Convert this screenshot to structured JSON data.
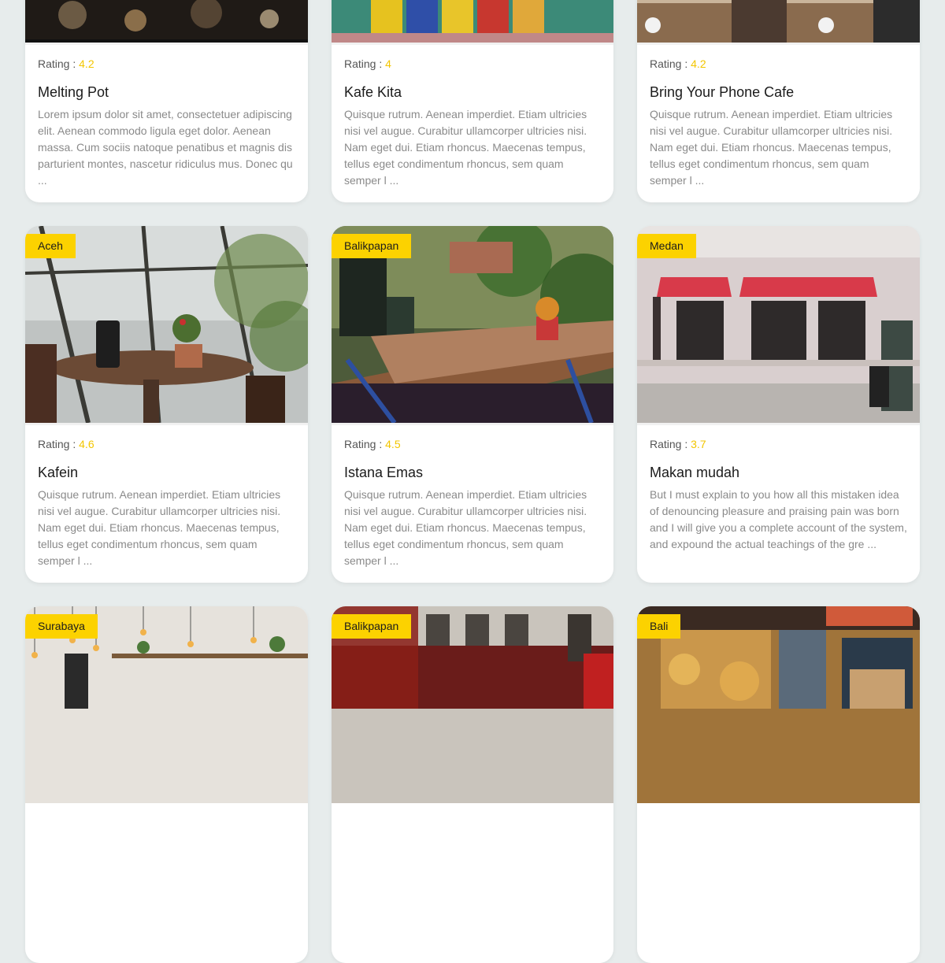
{
  "cards": [
    {
      "city": "",
      "rating_label": "Rating : ",
      "rating": "4.2",
      "title": "Melting Pot",
      "description": "Lorem ipsum dolor sit amet, consectetuer adipiscing elit. Aenean commodo ligula eget dolor. Aenean massa. Cum sociis natoque penatibus et magnis dis parturient montes, nascetur ridiculus mus. Donec qu ..."
    },
    {
      "city": "",
      "rating_label": "Rating : ",
      "rating": "4",
      "title": "Kafe Kita",
      "description": "Quisque rutrum. Aenean imperdiet. Etiam ultricies nisi vel augue. Curabitur ullamcorper ultricies nisi. Nam eget dui. Etiam rhoncus. Maecenas tempus, tellus eget condimentum rhoncus, sem quam semper l ..."
    },
    {
      "city": "",
      "rating_label": "Rating : ",
      "rating": "4.2",
      "title": "Bring Your Phone Cafe",
      "description": "Quisque rutrum. Aenean imperdiet. Etiam ultricies nisi vel augue. Curabitur ullamcorper ultricies nisi. Nam eget dui. Etiam rhoncus. Maecenas tempus, tellus eget condimentum rhoncus, sem quam semper l ..."
    },
    {
      "city": "Aceh",
      "rating_label": "Rating : ",
      "rating": "4.6",
      "title": "Kafein",
      "description": "Quisque rutrum. Aenean imperdiet. Etiam ultricies nisi vel augue. Curabitur ullamcorper ultricies nisi. Nam eget dui. Etiam rhoncus. Maecenas tempus, tellus eget condimentum rhoncus, sem quam semper l ..."
    },
    {
      "city": "Balikpapan",
      "rating_label": "Rating : ",
      "rating": "4.5",
      "title": "Istana Emas",
      "description": "Quisque rutrum. Aenean imperdiet. Etiam ultricies nisi vel augue. Curabitur ullamcorper ultricies nisi. Nam eget dui. Etiam rhoncus. Maecenas tempus, tellus eget condimentum rhoncus, sem quam semper l ..."
    },
    {
      "city": "Medan",
      "rating_label": "Rating : ",
      "rating": "3.7",
      "title": "Makan mudah",
      "description": "But I must explain to you how all this mistaken idea of denouncing pleasure and praising pain was born and I will give you a complete account of the system, and expound the actual teachings of the gre ..."
    },
    {
      "city": "Surabaya",
      "rating_label": "",
      "rating": "",
      "title": "",
      "description": ""
    },
    {
      "city": "Balikpapan",
      "rating_label": "",
      "rating": "",
      "title": "",
      "description": ""
    },
    {
      "city": "Bali",
      "rating_label": "",
      "rating": "",
      "title": "",
      "description": ""
    }
  ],
  "colors": {
    "background": "#e7ecec",
    "badge": "#fcd200",
    "rating": "#f3c600",
    "card": "#ffffff"
  }
}
